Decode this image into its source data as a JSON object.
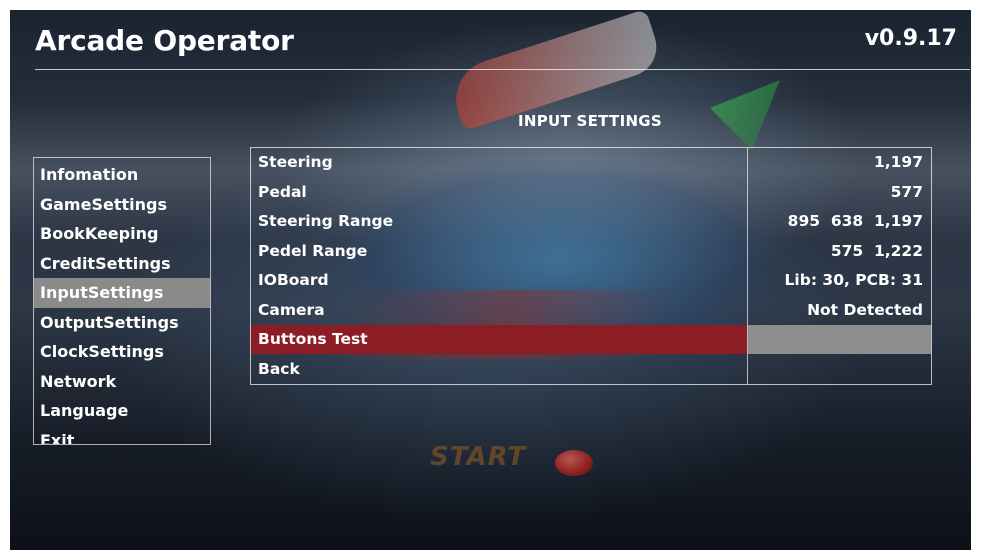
{
  "header": {
    "app_title": "Arcade Operator",
    "version": "v0.9.17"
  },
  "section_title": "INPUT SETTINGS",
  "menu": {
    "items": [
      {
        "label": "Infomation"
      },
      {
        "label": "GameSettings"
      },
      {
        "label": "BookKeeping"
      },
      {
        "label": "CreditSettings"
      },
      {
        "label": "InputSettings"
      },
      {
        "label": "OutputSettings"
      },
      {
        "label": "ClockSettings"
      },
      {
        "label": "Network"
      },
      {
        "label": "Language"
      },
      {
        "label": "Exit"
      }
    ],
    "selected": "InputSettings"
  },
  "input_table": {
    "rows": [
      {
        "label": "Steering",
        "value": "1,197"
      },
      {
        "label": "Pedal",
        "value": "577"
      },
      {
        "label": "Steering Range",
        "value": "895  638  1,197"
      },
      {
        "label": "Pedel Range",
        "value": "575  1,222"
      },
      {
        "label": "IOBoard",
        "value": "Lib: 30, PCB: 31"
      },
      {
        "label": "Camera",
        "value": "Not Detected"
      },
      {
        "label": "Buttons Test",
        "value": ""
      },
      {
        "label": "Back",
        "value": ""
      }
    ],
    "highlighted_row": "Buttons Test"
  },
  "background": {
    "start_text": "START"
  },
  "colors": {
    "selected_menu_bg": "#8a8a8a",
    "highlight_row_bg": "#8c1d24",
    "highlight_value_bg": "#8e8e8e",
    "text": "#ffffff"
  }
}
